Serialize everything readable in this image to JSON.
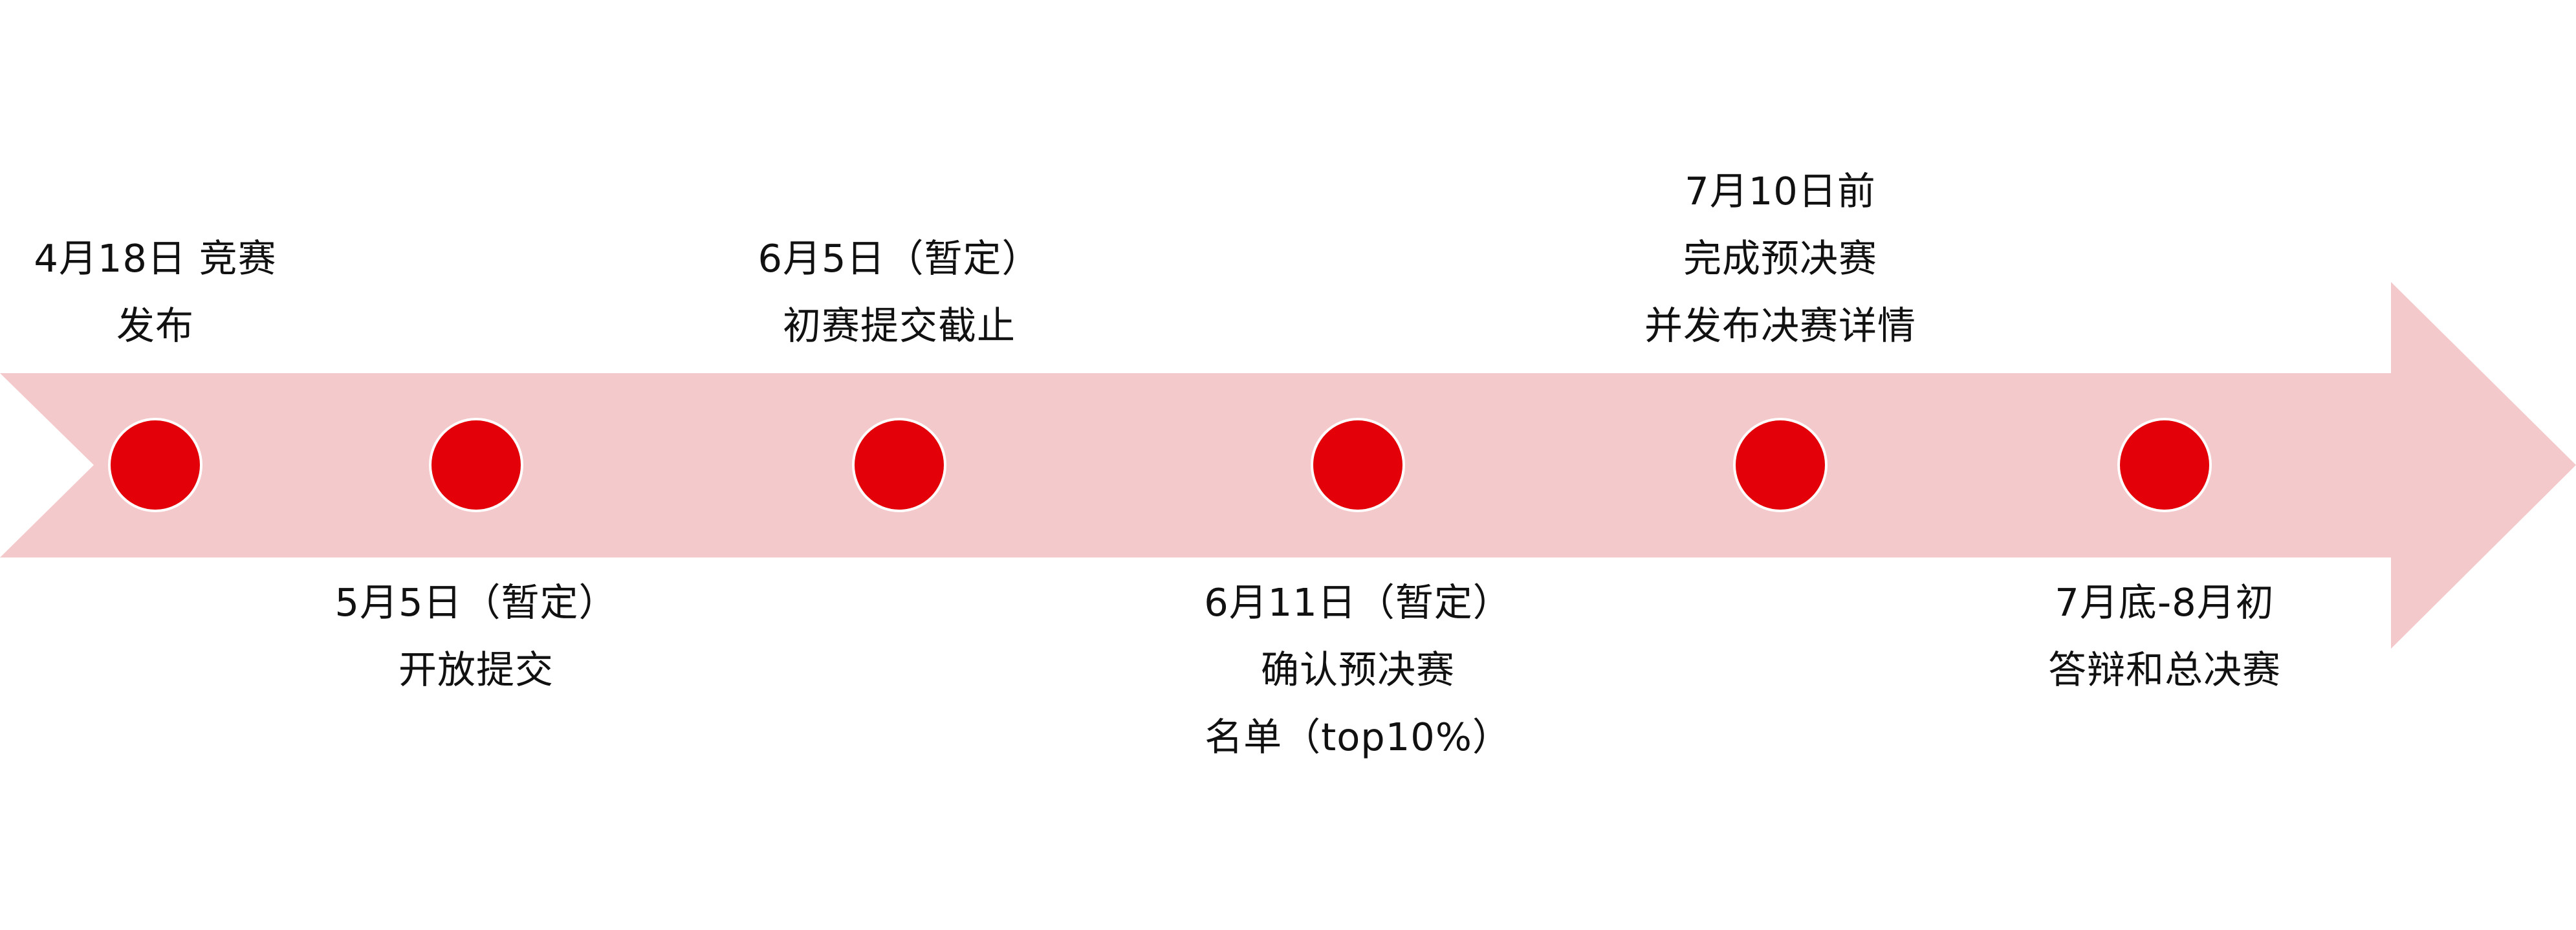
{
  "colors": {
    "arrow_fill": "#f4c9cb",
    "dot_fill": "#e30008",
    "dot_border": "#ffffff",
    "text": "#111111"
  },
  "milestones": [
    {
      "lines": [
        "4月18日 竞赛",
        "发布"
      ],
      "position": "above"
    },
    {
      "lines": [
        "5月5日（暂定）",
        "开放提交"
      ],
      "position": "below"
    },
    {
      "lines": [
        "6月5日（暂定）",
        "初赛提交截止"
      ],
      "position": "above"
    },
    {
      "lines": [
        "6月11日（暂定）",
        "确认预决赛",
        "名单（top10%）"
      ],
      "position": "below"
    },
    {
      "lines": [
        "7月10日前",
        "完成预决赛",
        "并发布决赛详情"
      ],
      "position": "above"
    },
    {
      "lines": [
        "7月底-8月初",
        "答辩和总决赛"
      ],
      "position": "below"
    }
  ]
}
